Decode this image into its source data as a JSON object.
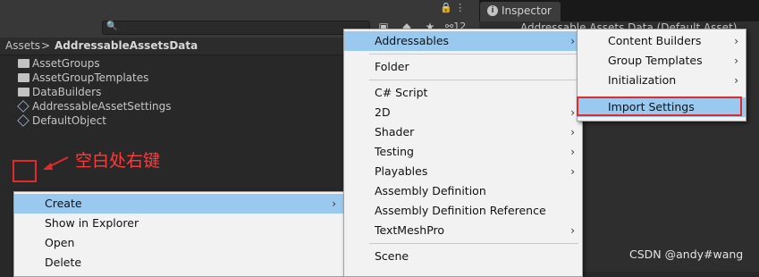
{
  "toolbar": {
    "search_icon": "🔍",
    "menu_dots": "⋮",
    "lock_icon": "🔒",
    "badge_count": "⚯12"
  },
  "inspector": {
    "tab_label": "Inspector",
    "title_partial": "Addressable Assets Data (Default Asset)"
  },
  "breadcrumb": {
    "root": "Assets",
    "separator": ">",
    "current": "AddressableAssetsData"
  },
  "files": [
    {
      "name": "AssetGroups",
      "icon": "folder-icon"
    },
    {
      "name": "AssetGroupTemplates",
      "icon": "folder-icon"
    },
    {
      "name": "DataBuilders",
      "icon": "folder-icon"
    },
    {
      "name": "AddressableAssetSettings",
      "icon": "scriptable-object-icon"
    },
    {
      "name": "DefaultObject",
      "icon": "scriptable-object-icon"
    }
  ],
  "annotation": {
    "note": "空白处右键",
    "color": "#e12a2a"
  },
  "context_menu": [
    {
      "label": "Create",
      "submenu": true,
      "highlighted": true
    },
    {
      "label": "Show in Explorer",
      "submenu": false
    },
    {
      "label": "Open",
      "submenu": false
    },
    {
      "label": "Delete",
      "submenu": false
    }
  ],
  "create_menu": [
    {
      "label": "Addressables",
      "submenu": true,
      "highlighted": true
    },
    {
      "label": "Folder",
      "submenu": false
    },
    {
      "label": "C# Script",
      "submenu": false
    },
    {
      "label": "2D",
      "submenu": true
    },
    {
      "label": "Shader",
      "submenu": true
    },
    {
      "label": "Testing",
      "submenu": true
    },
    {
      "label": "Playables",
      "submenu": true
    },
    {
      "label": "Assembly Definition",
      "submenu": false
    },
    {
      "label": "Assembly Definition Reference",
      "submenu": false
    },
    {
      "label": "TextMeshPro",
      "submenu": true
    },
    {
      "label": "Scene",
      "submenu": false
    }
  ],
  "addressables_menu": [
    {
      "label": "Content Builders",
      "submenu": true
    },
    {
      "label": "Group Templates",
      "submenu": true
    },
    {
      "label": "Initialization",
      "submenu": true
    },
    {
      "label": "Import Settings",
      "submenu": false
    }
  ],
  "watermark": "CSDN @andy#wang"
}
